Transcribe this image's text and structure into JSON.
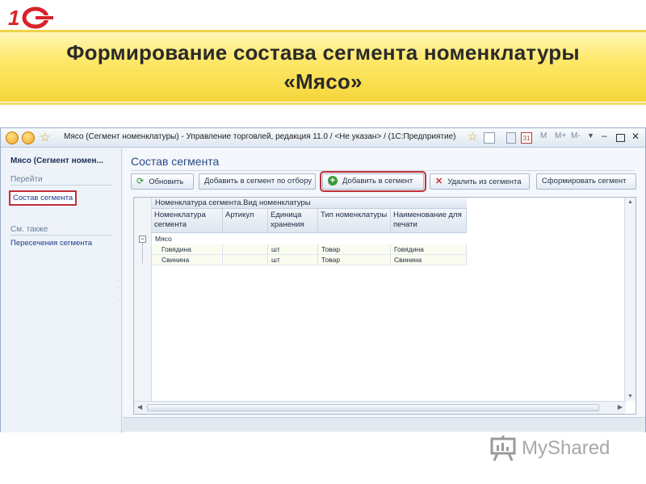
{
  "slide": {
    "title_line1": "Формирование состава сегмента номенклатуры",
    "title_line2": "«Мясо»",
    "logo_text": "1С"
  },
  "window": {
    "title": "Мясо (Сегмент номенклатуры) - Управление торговлей, редакция 11.0 / <Не указан> / (1С:Предприятие)",
    "toolbar_icons": [
      "m-icon",
      "m-plus-icon",
      "m-minus-icon"
    ],
    "right_labels": {
      "m": "M",
      "mplus": "M+",
      "mminus": "M-"
    }
  },
  "nav": {
    "header": "Мясо (Сегмент номен...",
    "section_go": "Перейти",
    "link_composition": "Состав сегмента",
    "section_see_also": "См. также",
    "link_intersections": "Пересечения сегмента"
  },
  "content": {
    "title": "Состав сегмента",
    "toolbar": {
      "refresh": "Обновить",
      "add_by_selection": "Добавить в сегмент по отбору",
      "add": "Добавить в сегмент",
      "remove": "Удалить из сегмента",
      "form": "Сформировать сегмент"
    },
    "table": {
      "group_header": "Номенклатура сегмента.Вид номенклатуры",
      "columns": [
        "Номенклатура сегмента",
        "Артикул",
        "Единица хранения",
        "Тип номенклатуры",
        "Наименование для печати"
      ],
      "group_label": "Мясо",
      "rows": [
        [
          "Говядина",
          "",
          "шт",
          "Товар",
          "Говядина"
        ],
        [
          "Свинина",
          "",
          "шт",
          "Товар",
          "Свинина"
        ]
      ]
    }
  },
  "watermark": {
    "text": "MyShared"
  },
  "colors": {
    "title_band": "#f4d63a",
    "highlight_outline": "#c0303a",
    "nav_link": "#1a3a8c",
    "content_title": "#2a4d86"
  }
}
